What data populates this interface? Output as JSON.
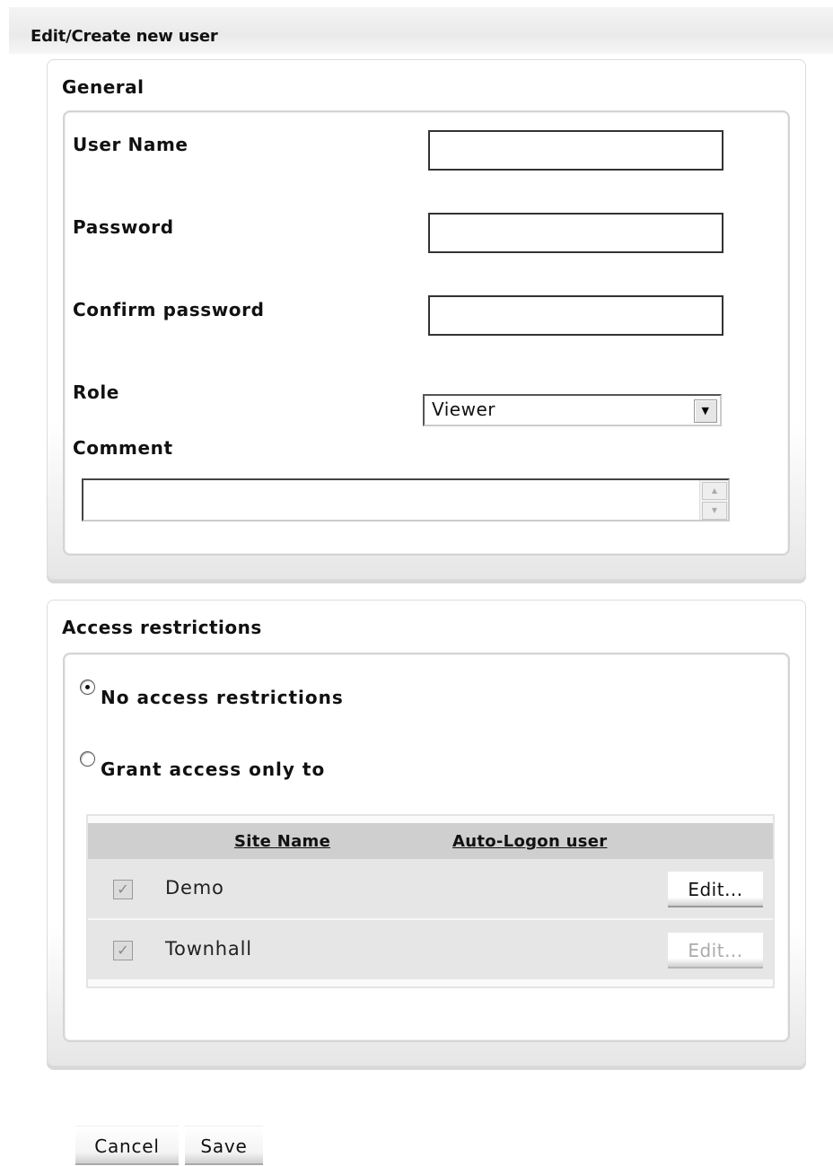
{
  "page": {
    "title": "Edit/Create new user"
  },
  "general": {
    "title": "General",
    "user_name_label": "User Name",
    "user_name_value": "",
    "password_label": "Password",
    "password_value": "",
    "confirm_password_label": "Confirm password",
    "confirm_password_value": "",
    "role_label": "Role",
    "role_selected": "Viewer",
    "comment_label": "Comment",
    "comment_value": ""
  },
  "access": {
    "title": "Access restrictions",
    "option_none_label": "No access restrictions",
    "option_none_selected": true,
    "option_grant_label": "Grant access only to",
    "option_grant_selected": false,
    "table": {
      "columns": [
        "Site Name",
        "Auto-Logon user"
      ],
      "rows": [
        {
          "site_name": "Demo",
          "auto_logon_user": "",
          "checked": true,
          "edit_label": "Edit...",
          "edit_enabled": true
        },
        {
          "site_name": "Townhall",
          "auto_logon_user": "",
          "checked": true,
          "edit_label": "Edit...",
          "edit_enabled": false
        }
      ]
    }
  },
  "footer": {
    "cancel_label": "Cancel",
    "save_label": "Save"
  },
  "icons": {
    "select_arrow": "chevron-down-icon",
    "checkbox_check": "checkmark-icon",
    "scroll_up": "scroll-up-icon",
    "scroll_down": "scroll-down-icon"
  }
}
